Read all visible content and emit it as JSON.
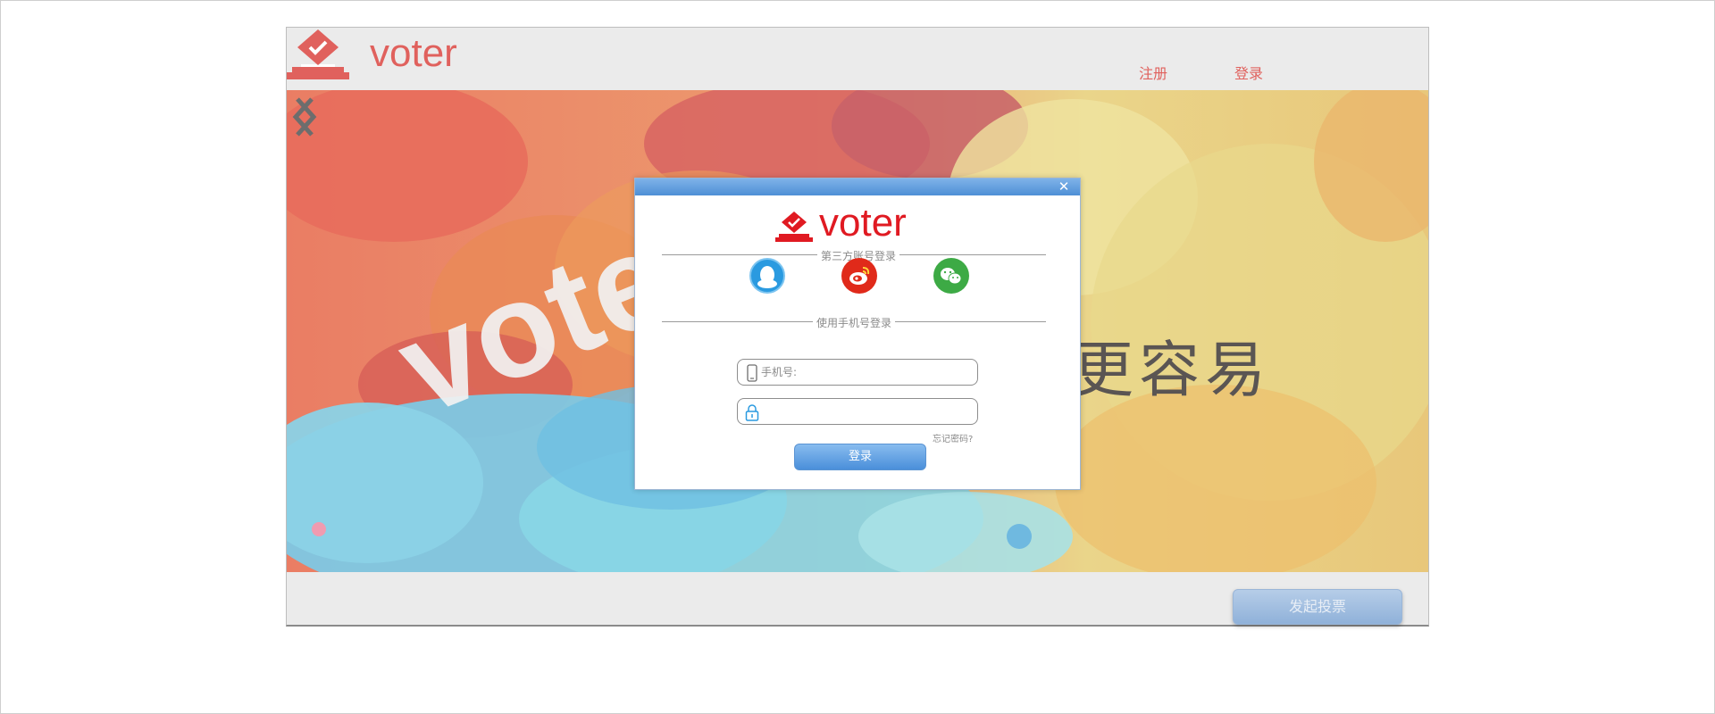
{
  "header": {
    "logo_text": "voter",
    "nav": {
      "register": "注册",
      "login": "登录"
    }
  },
  "banner": {
    "watermark_text": "voter",
    "tagline": "更容易"
  },
  "footer": {
    "start_vote_label": "发起投票"
  },
  "login_modal": {
    "close_symbol": "✕",
    "logo_text": "voter",
    "third_party_label": "第三方账号登录",
    "phone_login_label": "使用手机号登录",
    "social_icons": [
      "qq-icon",
      "weibo-icon",
      "wechat-icon"
    ],
    "phone_placeholder": "手机号:",
    "password_placeholder": "",
    "forgot_password": "忘记密码?",
    "login_button": "登录"
  },
  "colors": {
    "brand_red": "#e0615d",
    "modal_logo_red": "#e01a22",
    "titlebar_blue": "#4e8fd6",
    "button_blue": "#4a8fda"
  }
}
